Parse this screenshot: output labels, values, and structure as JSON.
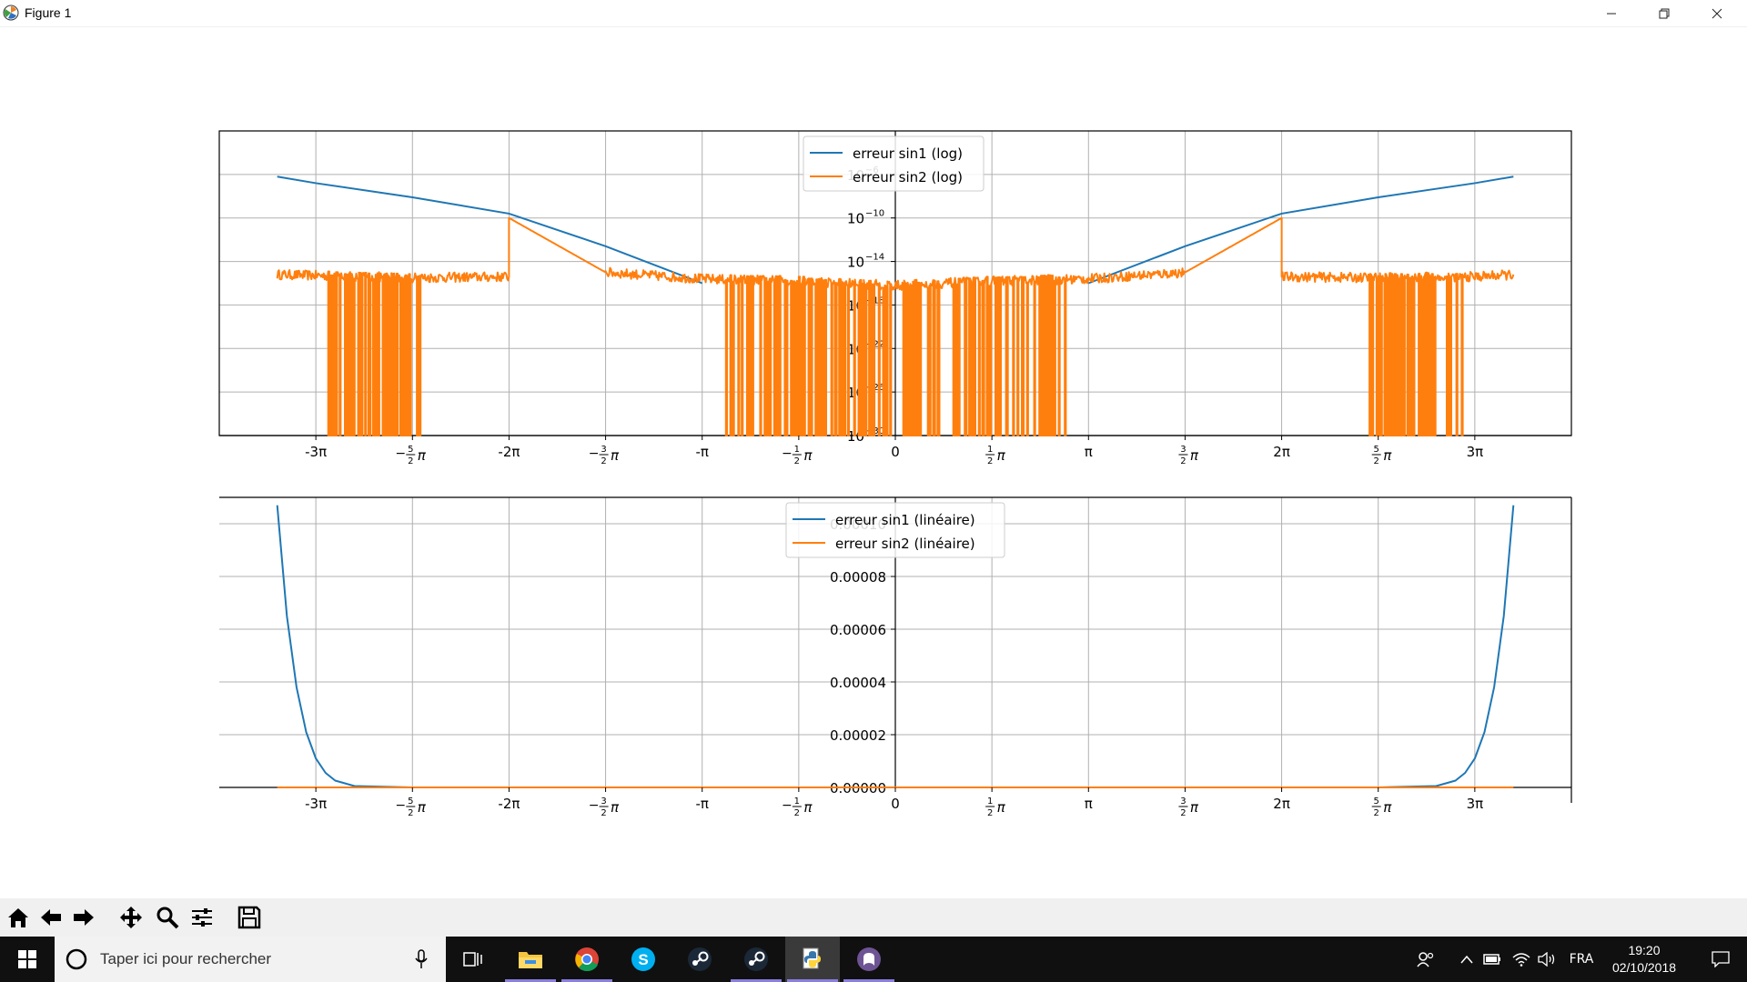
{
  "window": {
    "title": "Figure 1",
    "controls": [
      "minimize-icon",
      "restore-icon",
      "close-icon"
    ]
  },
  "toolbar": {
    "buttons": [
      "home-icon",
      "back-icon",
      "forward-icon",
      "pan-icon",
      "zoom-icon",
      "configure-subplots-icon",
      "save-icon"
    ]
  },
  "chart_data": [
    {
      "type": "line",
      "yscale": "log",
      "x_tick_labels": [
        "-3π",
        "-5/2π",
        "-2π",
        "-3/2π",
        "-π",
        "-1/2π",
        "0",
        "1/2π",
        "π",
        "3/2π",
        "2π",
        "5/2π",
        "3π"
      ],
      "x_tick_values_over_pi": [
        -3,
        -2.5,
        -2,
        -1.5,
        -1,
        -0.5,
        0,
        0.5,
        1,
        1.5,
        2,
        2.5,
        3
      ],
      "xlim_over_pi": [
        -3.5,
        3.5
      ],
      "y_tick_labels": [
        {
          "base": "10",
          "exp": "-6"
        },
        {
          "base": "10",
          "exp": "-10"
        },
        {
          "base": "10",
          "exp": "-14"
        },
        {
          "base": "10",
          "exp": "-18"
        },
        {
          "base": "10",
          "exp": "-22"
        },
        {
          "base": "10",
          "exp": "-26"
        },
        {
          "base": "10",
          "exp": "-30"
        }
      ],
      "y_tick_exponents": [
        -6,
        -10,
        -14,
        -18,
        -22,
        -26,
        -30
      ],
      "ylim_exponent": [
        -30,
        -2
      ],
      "grid": true,
      "legend": "upper center",
      "series": [
        {
          "name": "erreur sin1 (log)",
          "color": "#1f77b4",
          "x_over_pi": [
            -3.2,
            -3.0,
            -2.5,
            -2.0,
            -1.5,
            -1.0,
            1.0,
            1.5,
            2.0,
            2.5,
            3.0,
            3.2
          ],
          "log10_y": [
            -6.2,
            -6.8,
            -8.1,
            -9.6,
            -12.6,
            -16.0,
            -16.0,
            -12.6,
            -9.6,
            -8.1,
            -6.8,
            -6.2
          ]
        },
        {
          "name": "erreur sin2 (log)",
          "color": "#ff7f0e",
          "x_over_pi": [
            -3.2,
            -2.5,
            -2.0,
            -2.0,
            -1.5,
            -1.0,
            -0.5,
            0.0,
            0.5,
            1.0,
            1.5,
            2.0,
            2.0,
            2.5,
            3.0,
            3.2
          ],
          "log10_y": [
            -15.2,
            -15.5,
            -15.4,
            -10.0,
            -15.0,
            -15.6,
            -15.8,
            -16.2,
            -15.8,
            -15.6,
            -15.0,
            -10.0,
            -15.4,
            -15.5,
            -15.4,
            -15.2
          ]
        }
      ]
    },
    {
      "type": "line",
      "yscale": "linear",
      "x_tick_labels": [
        "-3π",
        "-5/2π",
        "-2π",
        "-3/2π",
        "-π",
        "-1/2π",
        "0",
        "1/2π",
        "π",
        "3/2π",
        "2π",
        "5/2π",
        "3π"
      ],
      "x_tick_values_over_pi": [
        -3,
        -2.5,
        -2,
        -1.5,
        -1,
        -0.5,
        0,
        0.5,
        1,
        1.5,
        2,
        2.5,
        3
      ],
      "xlim_over_pi": [
        -3.5,
        3.5
      ],
      "y_tick_labels": [
        "0.00000",
        "0.00002",
        "0.00004",
        "0.00006",
        "0.00008",
        "0.00010"
      ],
      "y_tick_values": [
        0,
        2e-05,
        4e-05,
        6e-05,
        8e-05,
        0.0001
      ],
      "ylim": [
        0,
        0.00011
      ],
      "grid": true,
      "legend": "upper center",
      "series": [
        {
          "name": "erreur sin1 (linéaire)",
          "color": "#1f77b4",
          "x_over_pi": [
            -3.2,
            -3.15,
            -3.1,
            -3.05,
            -3.0,
            -2.95,
            -2.9,
            -2.8,
            -2.5,
            0,
            2.5,
            2.8,
            2.9,
            2.95,
            3.0,
            3.05,
            3.1,
            3.15,
            3.2
          ],
          "y": [
            0.000107,
            6.5e-05,
            3.8e-05,
            2.1e-05,
            1.1e-05,
            5.5e-06,
            2.6e-06,
            5e-07,
            0,
            0,
            0,
            5e-07,
            2.6e-06,
            5.5e-06,
            1.1e-05,
            2.1e-05,
            3.8e-05,
            6.5e-05,
            0.000107
          ]
        },
        {
          "name": "erreur sin2 (linéaire)",
          "color": "#ff7f0e",
          "x_over_pi": [
            -3.2,
            3.2
          ],
          "y": [
            0,
            0
          ]
        }
      ]
    }
  ],
  "taskbar": {
    "search_placeholder": "Taper ici pour rechercher",
    "apps": [
      "task-view-icon",
      "file-explorer-icon",
      "chrome-icon",
      "skype-icon",
      "steam-icon",
      "steam-icon",
      "python-icon",
      "github-icon"
    ],
    "language": "FRA",
    "time": "19:20",
    "date": "02/10/2018"
  }
}
